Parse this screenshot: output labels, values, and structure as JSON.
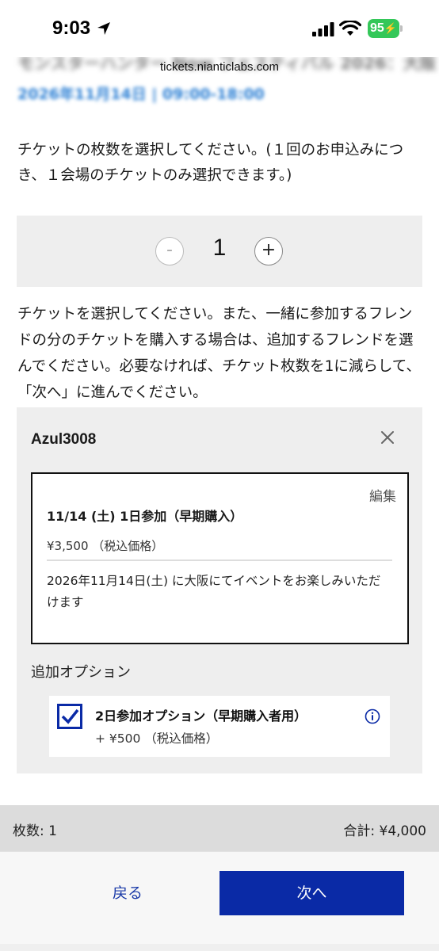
{
  "status_bar": {
    "time": "9:03",
    "battery": "95"
  },
  "browser": {
    "url": "tickets.nianticlabs.com"
  },
  "header": {
    "event_title": "モンスターハンター Now フェスティバル 2026：大阪",
    "event_date": "2026年11月14日 | 09:00-18:00"
  },
  "instructions": {
    "quantity": "チケットの枚数を選択してください。(１回のお申込みにつき、１会場のチケットのみ選択できます。)",
    "select": "チケットを選択してください。また、一緒に参加するフレンドの分のチケットを購入する場合は、追加するフレンドを選んでください。必要なければ、チケット枚数を1に減らして、「次へ」に進んでください。"
  },
  "stepper": {
    "minus": "-",
    "value": "1",
    "plus": "+"
  },
  "ticket_panel": {
    "user": "Azul3008",
    "edit": "編集",
    "ticket": {
      "title": "11/14 (土) 1日参加（早期購入）",
      "price": "¥3,500 （税込価格）",
      "description": "2026年11月14日(土) に大阪にてイベントをお楽しみいただけます"
    },
    "options_label": "追加オプション",
    "option": {
      "title": "2日参加オプション（早期購入者用）",
      "price": "+ ¥500 （税込価格）",
      "checked": true
    }
  },
  "summary": {
    "quantity": "枚数: 1",
    "total": "合計: ¥4,000"
  },
  "nav": {
    "back": "戻る",
    "next": "次へ"
  },
  "colors": {
    "primary": "#0a2aa6",
    "panel": "#eeeeee",
    "battery": "#34c759"
  }
}
